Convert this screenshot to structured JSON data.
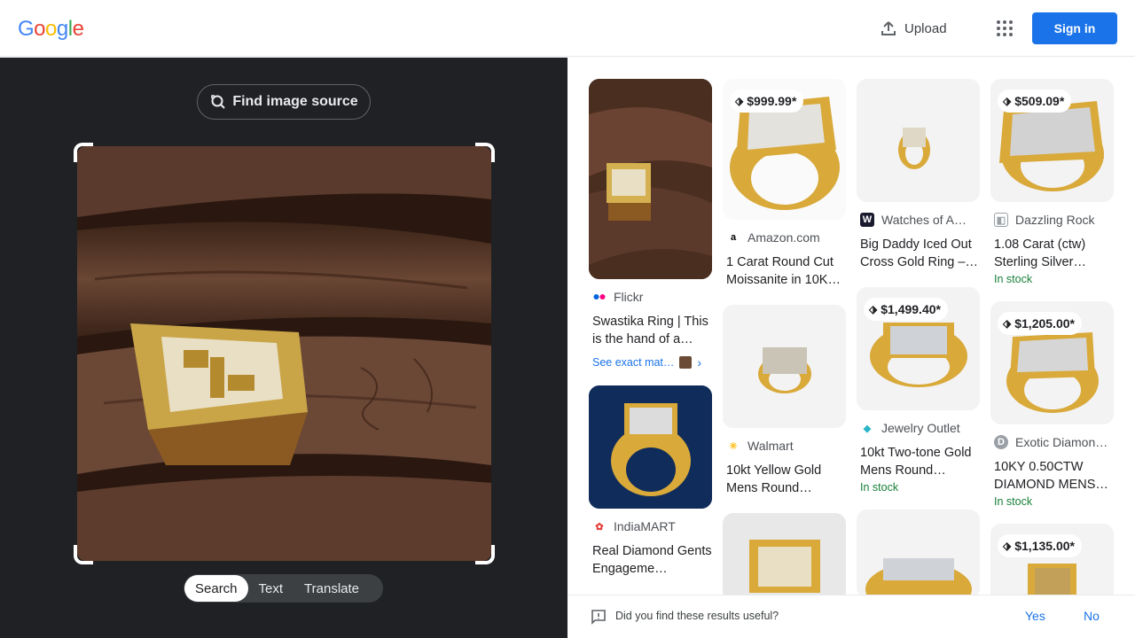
{
  "header": {
    "logo_letters": [
      "G",
      "o",
      "o",
      "g",
      "l",
      "e"
    ],
    "logo_colors": [
      "#4285f4",
      "#ea4335",
      "#fbbc05",
      "#4285f4",
      "#34a853",
      "#ea4335"
    ],
    "upload_label": "Upload",
    "apps_icon": "apps-grid-icon",
    "signin_label": "Sign in"
  },
  "left": {
    "find_source_label": "Find image source",
    "modes": [
      "Search",
      "Text",
      "Translate"
    ],
    "active_mode": "Search"
  },
  "results": [
    {
      "price": "",
      "source": "Flickr",
      "title": "Swastika Ring | This is the hand of a…",
      "stock": "",
      "exact_label": "See exact mat…"
    },
    {
      "price": "$999.99*",
      "source": "Amazon.com",
      "title": "1 Carat Round Cut Moissanite in 10K…",
      "stock": ""
    },
    {
      "price": "",
      "source": "Watches of A…",
      "title": "Big Daddy Iced Out Cross Gold Ring –…",
      "stock": ""
    },
    {
      "price": "$509.09*",
      "source": "Dazzling Rock",
      "title": "1.08 Carat (ctw) Sterling Silver…",
      "stock": "In stock"
    },
    {
      "price": "",
      "source": "IndiaMART",
      "title": "Real Diamond Gents Engageme…",
      "stock": ""
    },
    {
      "price": "",
      "source": "Walmart",
      "title": "10kt Yellow Gold Mens Round…",
      "stock": ""
    },
    {
      "price": "$1,499.40*",
      "source": "Jewelry Outlet",
      "title": "10kt Two-tone Gold Mens Round…",
      "stock": "In stock"
    },
    {
      "price": "$1,205.00*",
      "source": "Exotic Diamon…",
      "title": "10KY 0.50CTW DIAMOND MENS…",
      "stock": "In stock"
    },
    {
      "price": "$1,135.00*",
      "source": "",
      "title": "",
      "stock": ""
    }
  ],
  "feedback": {
    "question": "Did you find these results useful?",
    "yes_label": "Yes",
    "no_label": "No"
  },
  "colors": {
    "accent": "#1a73e8",
    "dark_panel": "#202124",
    "in_stock": "#188038",
    "gold": "#d9a93a"
  }
}
